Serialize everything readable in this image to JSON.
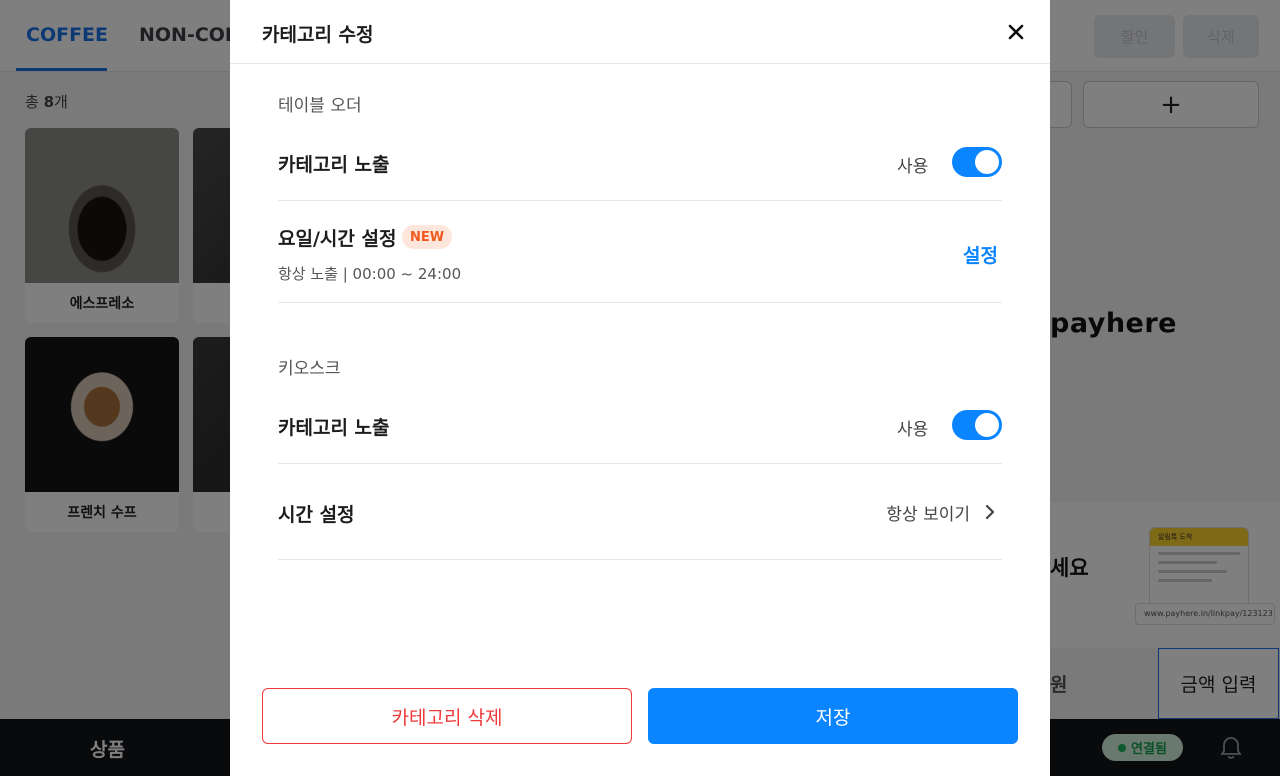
{
  "background": {
    "tabs": [
      "COFFEE",
      "NON-COF"
    ],
    "top_buttons": [
      "할인",
      "삭제"
    ],
    "plus_label": "+",
    "count_prefix": "총 ",
    "count_value": "8",
    "count_suffix": "개",
    "products": [
      {
        "name": "에스프레소"
      },
      {
        "name": "프렌치 수프"
      }
    ],
    "logo_text": "payhere",
    "promo_text": "세요",
    "promo_card_title": "알림톡 도착",
    "promo_link": "www.payhere.in/linkpay/123123",
    "amount_won": "원",
    "amount_input": "금액 입력",
    "bottom_label": "상품",
    "connection_status": "연결됨"
  },
  "modal": {
    "title": "카테고리 수정",
    "table_order": {
      "section_label": "테이블 오더",
      "exposure_title": "카테고리 노출",
      "exposure_use": "사용",
      "exposure_on": true,
      "schedule_title": "요일/시간 설정",
      "schedule_badge": "NEW",
      "schedule_sub": "항상 노출  |  00:00 ~ 24:00",
      "schedule_link": "설정"
    },
    "kiosk": {
      "section_label": "키오스크",
      "exposure_title": "카테고리 노출",
      "exposure_use": "사용",
      "exposure_on": true,
      "time_title": "시간 설정",
      "time_value": "항상 보이기"
    },
    "delete_button": "카테고리 삭제",
    "save_button": "저장"
  },
  "colors": {
    "accent": "#0a84ff",
    "danger": "#ef3b3b",
    "badge_bg": "#ffe6dc",
    "badge_text": "#f05a1e"
  }
}
